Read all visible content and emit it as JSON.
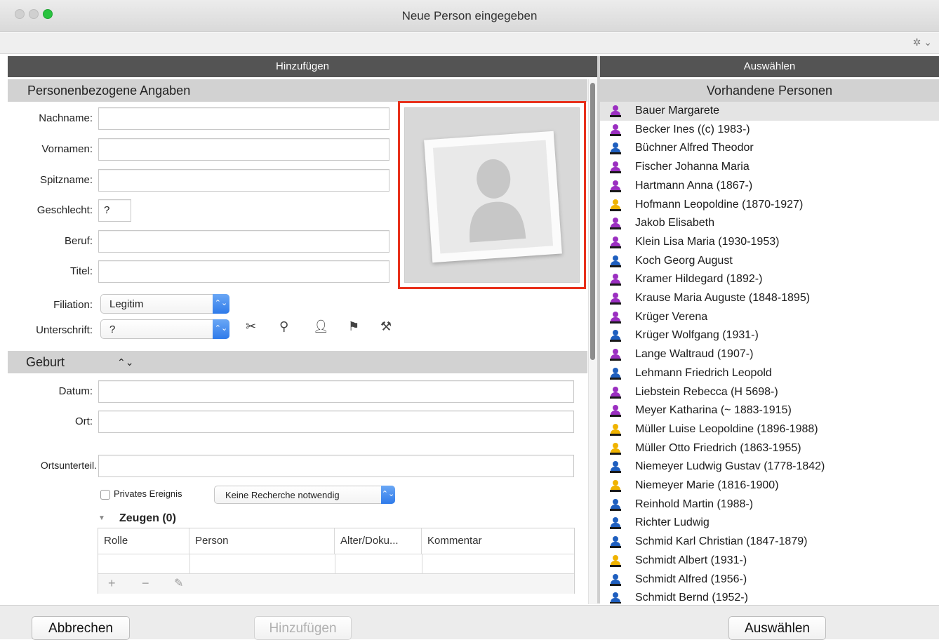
{
  "window": {
    "title": "Neue Person eingegeben"
  },
  "toolbar": {
    "gear_menu": "✲ ⌄"
  },
  "left_header": "Hinzufügen",
  "right_header": "Auswählen",
  "personal_section": {
    "title": "Personenbezogene Angaben",
    "labels": {
      "surname": "Nachname:",
      "first_names": "Vornamen:",
      "nickname": "Spitzname:",
      "gender": "Geschlecht:",
      "occupation": "Beruf:",
      "title": "Titel:",
      "filiation": "Filiation:",
      "signature": "Unterschrift:"
    },
    "values": {
      "surname": "",
      "first_names": "",
      "nickname": "",
      "gender": "?",
      "occupation": "",
      "title": "",
      "filiation": "Legitim",
      "signature": "?"
    }
  },
  "birth_section": {
    "title": "Geburt",
    "labels": {
      "date": "Datum:",
      "place": "Ort:",
      "place_part": "Ortsunterteil."
    },
    "values": {
      "date": "",
      "place": "",
      "place_part": ""
    },
    "private_event_label": "Privates Ereignis",
    "research_select": "Keine Recherche notwendig",
    "witnesses_label": "Zeugen (0)",
    "table_columns": [
      "Rolle",
      "Person",
      "Alter/Doku...",
      "Kommentar"
    ]
  },
  "existing_section": {
    "title": "Vorhandene Personen",
    "persons": [
      {
        "name": "Bauer Margarete",
        "color": "#9b2fc1",
        "selected": true
      },
      {
        "name": "Becker Ines ((c) 1983-)",
        "color": "#9b2fc1"
      },
      {
        "name": "Büchner Alfred Theodor",
        "color": "#1f5fbf"
      },
      {
        "name": "Fischer Johanna Maria",
        "color": "#9b2fc1"
      },
      {
        "name": "Hartmann Anna (1867-)",
        "color": "#9b2fc1"
      },
      {
        "name": "Hofmann Leopoldine (1870-1927)",
        "color": "#f0b300"
      },
      {
        "name": "Jakob Elisabeth",
        "color": "#9b2fc1"
      },
      {
        "name": "Klein Lisa Maria (1930-1953)",
        "color": "#9b2fc1"
      },
      {
        "name": "Koch Georg August",
        "color": "#1f5fbf"
      },
      {
        "name": "Kramer Hildegard (1892-)",
        "color": "#9b2fc1"
      },
      {
        "name": "Krause Maria Auguste (1848-1895)",
        "color": "#9b2fc1"
      },
      {
        "name": "Krüger Verena",
        "color": "#9b2fc1"
      },
      {
        "name": "Krüger Wolfgang (1931-)",
        "color": "#1f5fbf"
      },
      {
        "name": "Lange Waltraud (1907-)",
        "color": "#9b2fc1"
      },
      {
        "name": "Lehmann Friedrich Leopold",
        "color": "#1f5fbf"
      },
      {
        "name": "Liebstein Rebecca (H 5698-)",
        "color": "#9b2fc1"
      },
      {
        "name": "Meyer Katharina (~ 1883-1915)",
        "color": "#9b2fc1"
      },
      {
        "name": "Müller Luise Leopoldine (1896-1988)",
        "color": "#f0b300"
      },
      {
        "name": "Müller Otto Friedrich (1863-1955)",
        "color": "#f0b300"
      },
      {
        "name": "Niemeyer Ludwig Gustav (1778-1842)",
        "color": "#1f5fbf"
      },
      {
        "name": "Niemeyer Marie (1816-1900)",
        "color": "#f0b300"
      },
      {
        "name": "Reinhold Martin (1988-)",
        "color": "#1f5fbf"
      },
      {
        "name": "Richter Ludwig",
        "color": "#1f5fbf"
      },
      {
        "name": "Schmid Karl Christian (1847-1879)",
        "color": "#1f5fbf"
      },
      {
        "name": "Schmidt Albert (1931-)",
        "color": "#f0b300"
      },
      {
        "name": "Schmidt Alfred (1956-)",
        "color": "#1f5fbf"
      },
      {
        "name": "Schmidt Bernd (1952-)",
        "color": "#1f5fbf"
      }
    ]
  },
  "buttons": {
    "cancel": "Abbrechen",
    "add": "Hinzufügen",
    "select": "Auswählen"
  },
  "colors": {
    "highlight_frame": "#e8301b",
    "female": "#9b2fc1",
    "male": "#1f5fbf",
    "unknown": "#f0b300"
  }
}
